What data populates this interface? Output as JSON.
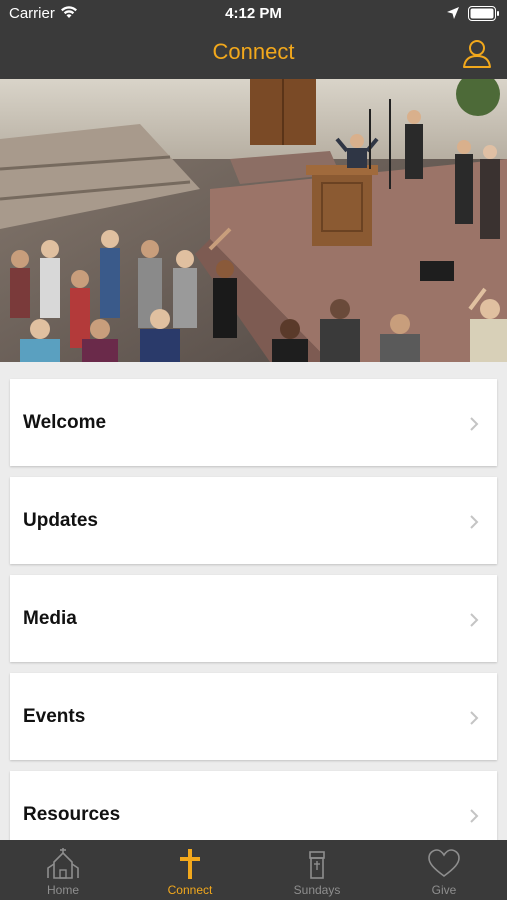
{
  "status_bar": {
    "carrier": "Carrier",
    "time": "4:12 PM"
  },
  "header": {
    "title": "Connect",
    "profile_icon": "person-icon"
  },
  "hero": {
    "description_icon": "church-worship-photo"
  },
  "menu": {
    "items": [
      {
        "label": "Welcome"
      },
      {
        "label": "Updates"
      },
      {
        "label": "Media"
      },
      {
        "label": "Events"
      },
      {
        "label": "Resources"
      }
    ]
  },
  "tab_bar": {
    "tabs": [
      {
        "label": "Home",
        "icon": "church-icon",
        "active": false
      },
      {
        "label": "Connect",
        "icon": "cross-icon",
        "active": true
      },
      {
        "label": "Sundays",
        "icon": "pulpit-icon",
        "active": false
      },
      {
        "label": "Give",
        "icon": "heart-icon",
        "active": false
      }
    ]
  },
  "colors": {
    "accent": "#f2a81c",
    "bar_background": "#3a3a3a",
    "page_background": "#ececec",
    "inactive_tab": "#8e8e8e"
  }
}
